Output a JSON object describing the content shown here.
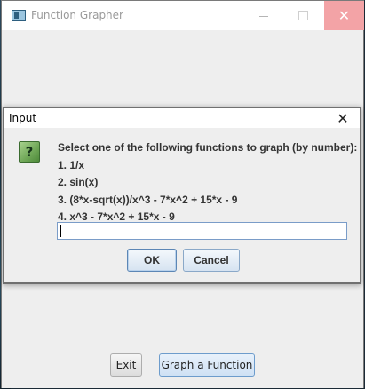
{
  "main_window": {
    "title": "Function Grapher",
    "icon": "java-window-icon",
    "buttons": {
      "exit_label": "Exit",
      "graph_label": "Graph a Function"
    }
  },
  "dialog": {
    "title": "Input",
    "icon": "question-icon",
    "icon_glyph": "?",
    "prompt_lines": [
      "Select one of the following functions to graph (by number):",
      "1. 1/x",
      "2. sin(x)",
      "3. (8*x-sqrt(x))/x^3 - 7*x^2 + 15*x - 9",
      "4. x^3 - 7*x^2 + 15*x - 9"
    ],
    "input_value": "",
    "ok_label": "OK",
    "cancel_label": "Cancel"
  },
  "colors": {
    "close_hover": "#f3a3a6",
    "question_icon": "#6ea656",
    "focus_border": "#7a9cc8"
  }
}
